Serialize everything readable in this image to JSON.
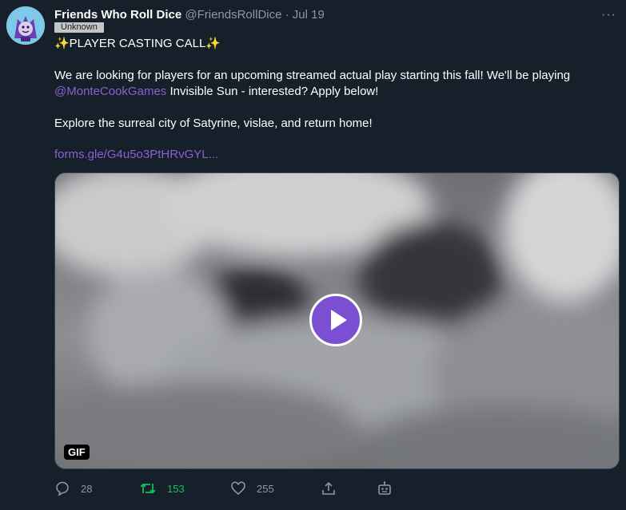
{
  "account": {
    "display_name": "Friends Who Roll Dice",
    "handle": "@FriendsRollDice",
    "separator": "·",
    "date": "Jul 19",
    "badge": "Unknown"
  },
  "tweet": {
    "line1": "✨PLAYER CASTING CALL✨",
    "line2": "We are looking for players for an upcoming streamed actual play starting this fall! We'll be playing",
    "mention": "@MonteCookGames",
    "line3_rest": " Invisible Sun - interested? Apply below!",
    "line4": "Explore the surreal city of Satyrine, vislae, and return home!",
    "link": "forms.gle/G4u5o3PtHRvGYL..."
  },
  "media": {
    "badge": "GIF",
    "play_icon": "play-icon"
  },
  "actions": {
    "reply": {
      "icon": "reply-icon",
      "count": "28"
    },
    "retweet": {
      "icon": "retweet-icon",
      "count": "153",
      "color": "#17bf63"
    },
    "like": {
      "icon": "heart-icon",
      "count": "255"
    },
    "share": {
      "icon": "share-icon"
    },
    "analytics": {
      "icon": "robot-icon"
    }
  },
  "colors": {
    "background": "#15202b",
    "accent": "#8c5fd4",
    "muted": "#8b98a5",
    "retweet": "#17bf63"
  }
}
